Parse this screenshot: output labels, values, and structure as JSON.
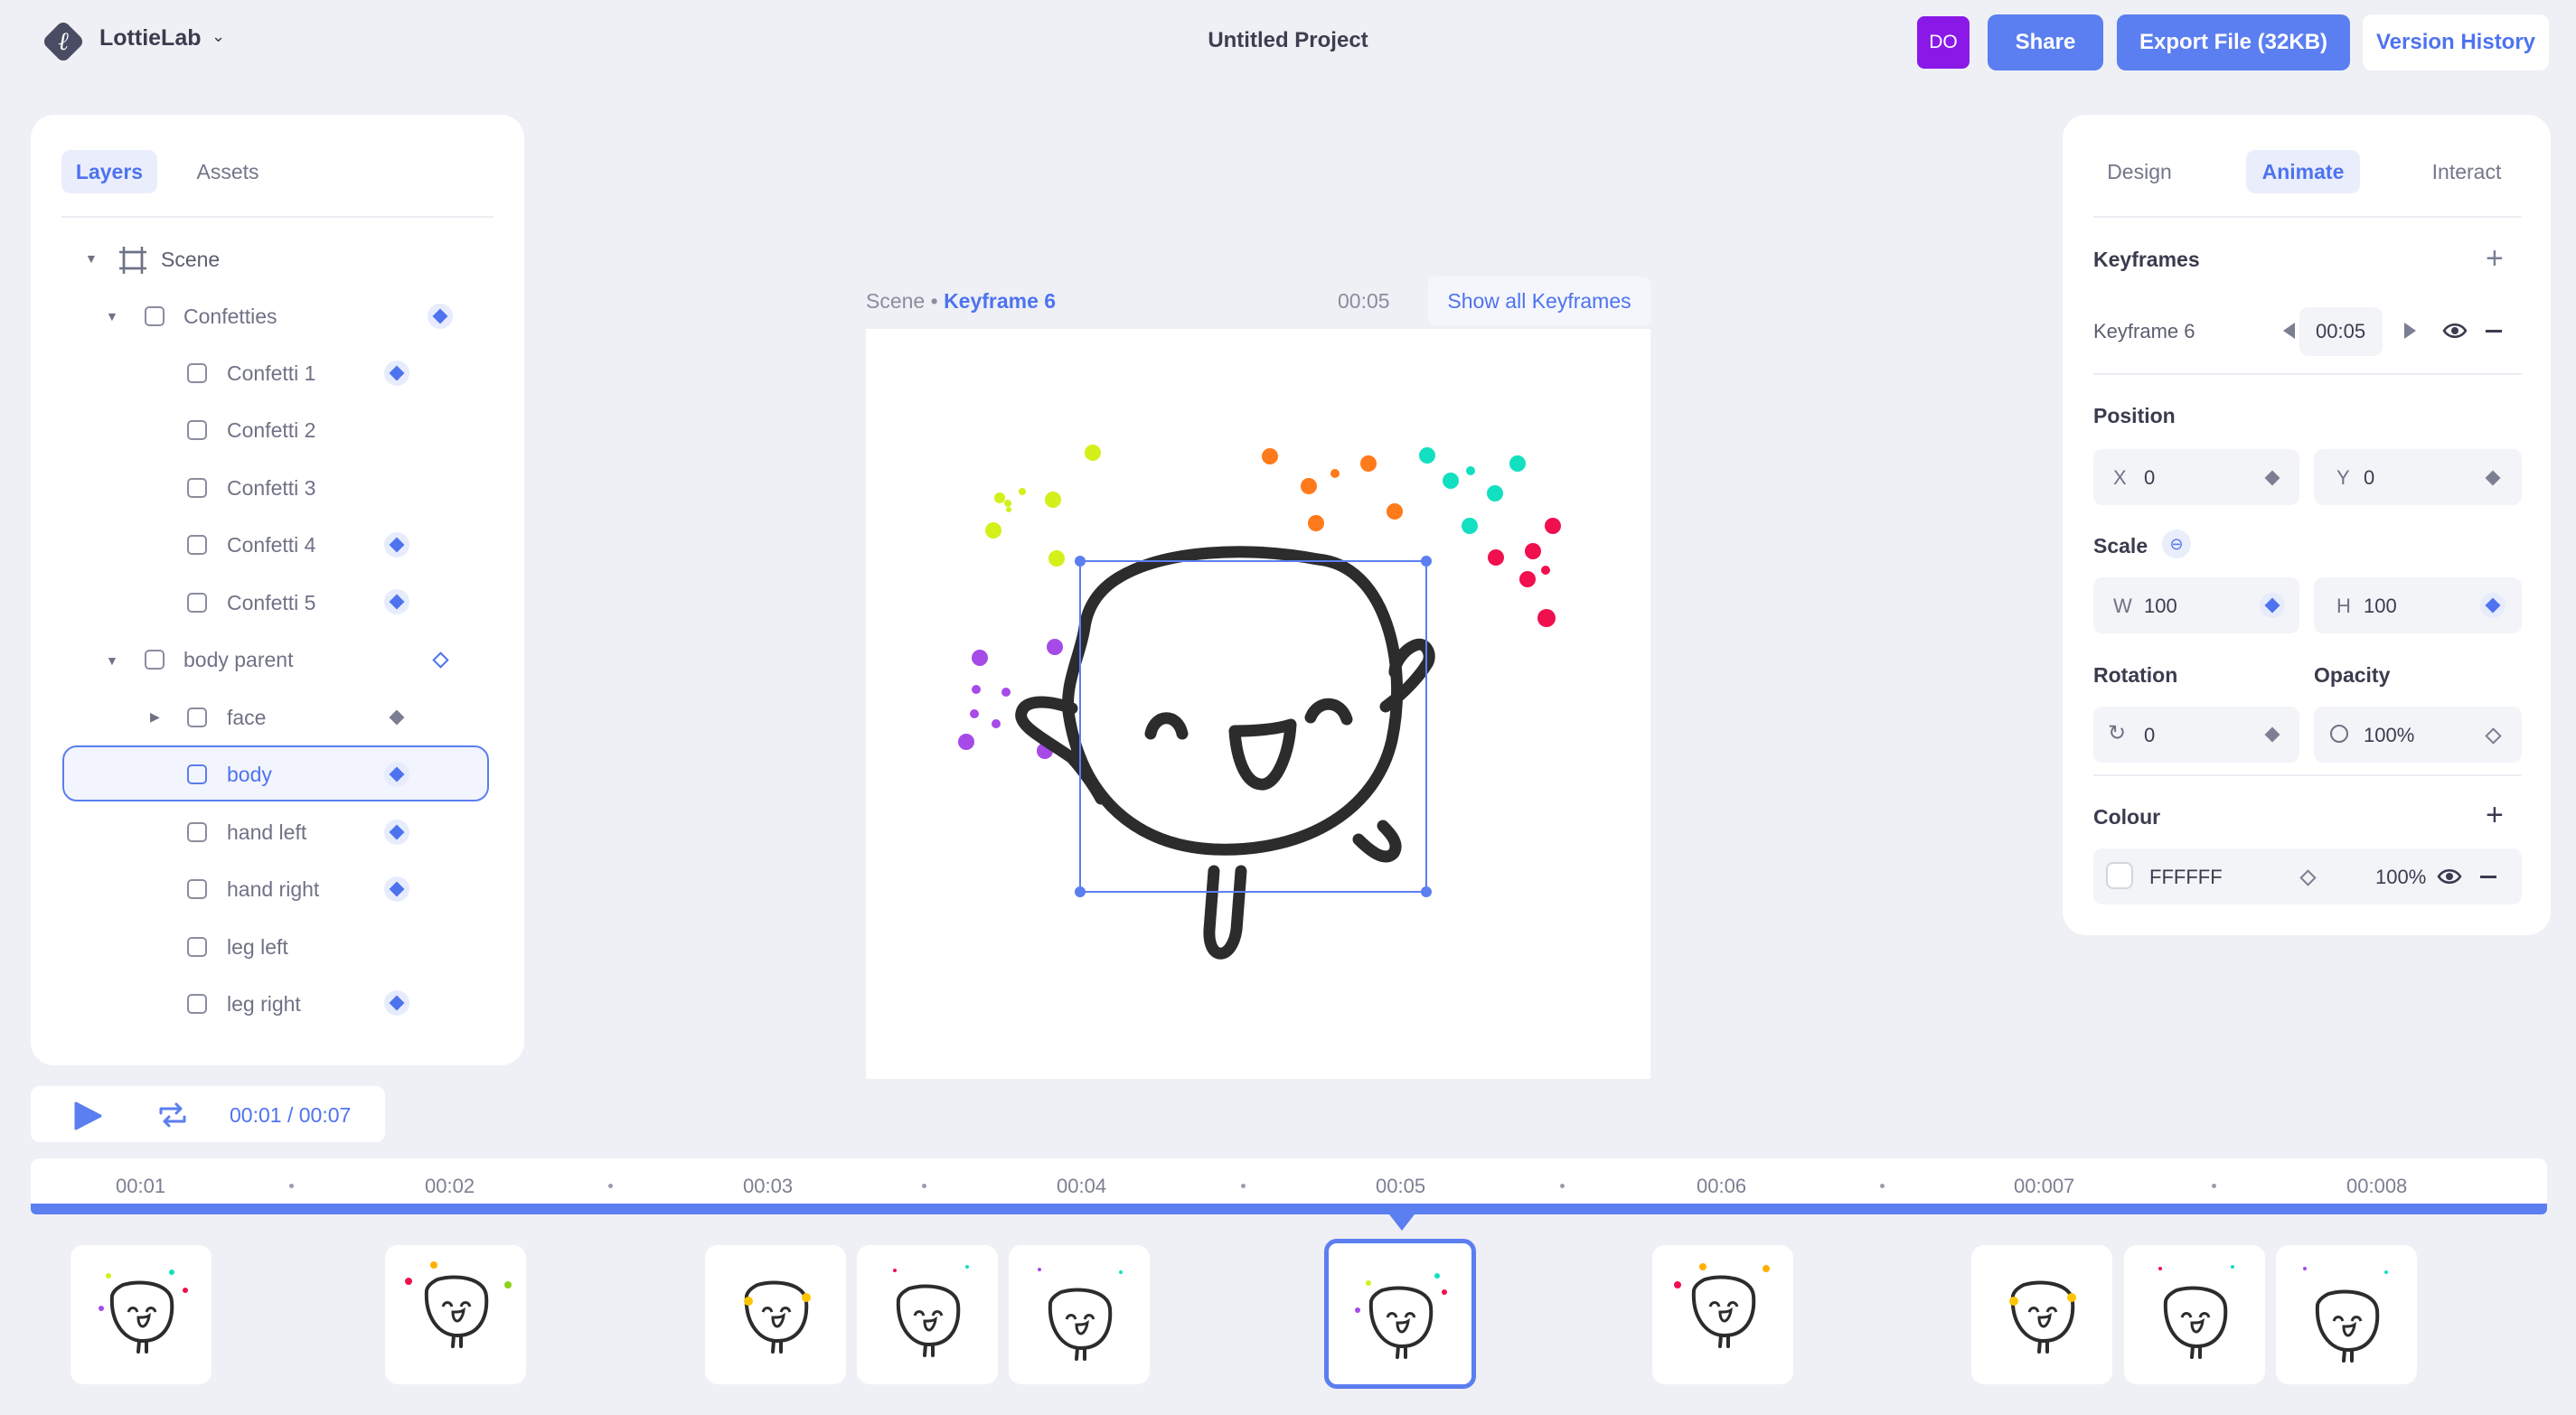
{
  "app": {
    "brand": "LottieLab",
    "project_title": "Untitled Project",
    "avatar_initials": "DO",
    "share_label": "Share",
    "export_label": "Export File (32KB)",
    "version_history_label": "Version History"
  },
  "left_panel": {
    "tabs": [
      "Layers",
      "Assets"
    ],
    "active_tab": "Layers",
    "layers": [
      {
        "name": "Scene",
        "type": "scene",
        "expanded": true
      },
      {
        "name": "Confetties",
        "keyframe": "filled",
        "expanded": true
      },
      {
        "name": "Confetti 1",
        "keyframe": "filled"
      },
      {
        "name": "Confetti 2",
        "keyframe": "none"
      },
      {
        "name": "Confetti 3",
        "keyframe": "none"
      },
      {
        "name": "Confetti 4",
        "keyframe": "filled"
      },
      {
        "name": "Confetti 5",
        "keyframe": "filled"
      },
      {
        "name": "body parent",
        "keyframe": "outline",
        "expanded": true
      },
      {
        "name": "face",
        "keyframe": "gray",
        "collapsed": true
      },
      {
        "name": "body",
        "keyframe": "filled",
        "selected": true
      },
      {
        "name": "hand left",
        "keyframe": "filled"
      },
      {
        "name": "hand right",
        "keyframe": "filled"
      },
      {
        "name": "leg left",
        "keyframe": "none"
      },
      {
        "name": "leg right",
        "keyframe": "filled"
      }
    ]
  },
  "canvas": {
    "breadcrumb_scene": "Scene",
    "breadcrumb_sep": "•",
    "breadcrumb_keyframe": "Keyframe 6",
    "time": "00:05",
    "show_all_label": "Show all Keyframes"
  },
  "right_panel": {
    "tabs": [
      "Design",
      "Animate",
      "Interact"
    ],
    "active_tab": "Animate",
    "keyframes_title": "Keyframes",
    "keyframe_name": "Keyframe 6",
    "keyframe_time": "00:05",
    "position_title": "Position",
    "pos_x_label": "X",
    "pos_x": "0",
    "pos_y_label": "Y",
    "pos_y": "0",
    "scale_title": "Scale",
    "scale_w_label": "W",
    "scale_w": "100",
    "scale_h_label": "H",
    "scale_h": "100",
    "rotation_title": "Rotation",
    "rotation": "0",
    "opacity_title": "Opacity",
    "opacity": "100%",
    "colour_title": "Colour",
    "colour_hex": "FFFFFF",
    "colour_opacity": "100%"
  },
  "playback": {
    "current": "00:01",
    "sep": "/",
    "total": "00:07"
  },
  "timeline": {
    "labels": [
      "00:01",
      "00:02",
      "00:03",
      "00:04",
      "00:05",
      "00:06",
      "00:007",
      "00:008"
    ],
    "selected_label": "00:05"
  },
  "colors": {
    "accent": "#5b7ef0",
    "avatar": "#8a19e8",
    "confetti_lime": "#d4f01a",
    "confetti_orange": "#ff7a1a",
    "confetti_cyan": "#12e0c0",
    "confetti_red": "#f0104e",
    "confetti_purple": "#a64ae8"
  }
}
